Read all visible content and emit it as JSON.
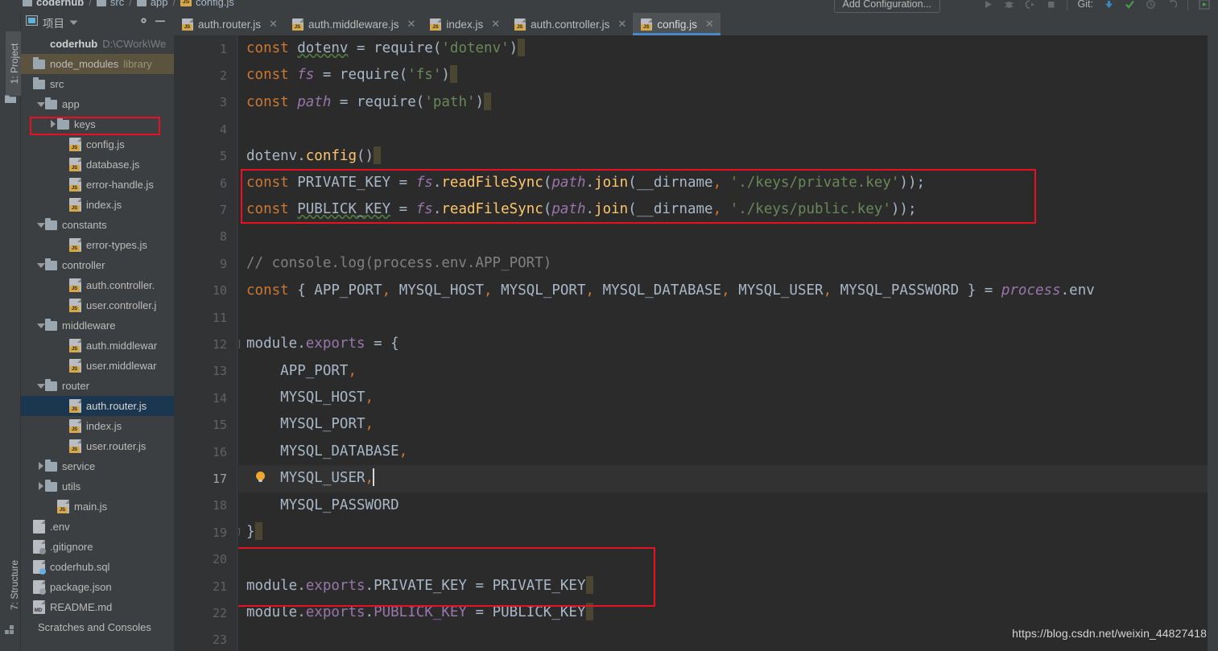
{
  "window": {
    "breadcrumb": [
      {
        "label": "coderhub",
        "icon": "folder-icon",
        "bold": true
      },
      {
        "label": "src",
        "icon": "folder-icon",
        "bold": false
      },
      {
        "label": "app",
        "icon": "folder-icon",
        "bold": false
      },
      {
        "label": "config.js",
        "icon": "js-file-icon",
        "bold": false
      }
    ],
    "run_configuration": "Add Configuration...",
    "git_label": "Git:",
    "watermark": "https://blog.csdn.net/weixin_44827418"
  },
  "toolstrips": {
    "left_top": "1: Project",
    "left_bottom": "7: Structure"
  },
  "project_panel": {
    "title": "项目",
    "dropdown_icon": "chevron-down-icon",
    "settings_icon": "gear-icon",
    "minimize_icon": "minimize-icon",
    "tree": [
      {
        "label": "coderhub",
        "sub": "D:\\CWork\\We",
        "indent": 0,
        "arrow": "none",
        "icon": "project-root",
        "bold": true,
        "state": "normal"
      },
      {
        "label": "node_modules",
        "sub": "library",
        "indent": 0,
        "arrow": "none",
        "icon": "folder-icon",
        "bold": false,
        "state": "library"
      },
      {
        "label": "src",
        "sub": "",
        "indent": 0,
        "arrow": "none",
        "icon": "folder-icon",
        "bold": false,
        "state": "normal"
      },
      {
        "label": "app",
        "sub": "",
        "indent": 1,
        "arrow": "down",
        "icon": "folder-icon",
        "bold": false,
        "state": "normal"
      },
      {
        "label": "keys",
        "sub": "",
        "indent": 2,
        "arrow": "right",
        "icon": "folder-icon",
        "bold": false,
        "state": "annotated"
      },
      {
        "label": "config.js",
        "sub": "",
        "indent": 3,
        "arrow": "none",
        "icon": "js-file-icon",
        "bold": false,
        "state": "normal"
      },
      {
        "label": "database.js",
        "sub": "",
        "indent": 3,
        "arrow": "none",
        "icon": "js-file-icon",
        "bold": false,
        "state": "normal"
      },
      {
        "label": "error-handle.js",
        "sub": "",
        "indent": 3,
        "arrow": "none",
        "icon": "js-file-icon",
        "bold": false,
        "state": "normal"
      },
      {
        "label": "index.js",
        "sub": "",
        "indent": 3,
        "arrow": "none",
        "icon": "js-file-icon",
        "bold": false,
        "state": "normal"
      },
      {
        "label": "constants",
        "sub": "",
        "indent": 1,
        "arrow": "down",
        "icon": "folder-icon",
        "bold": false,
        "state": "normal"
      },
      {
        "label": "error-types.js",
        "sub": "",
        "indent": 3,
        "arrow": "none",
        "icon": "js-file-icon",
        "bold": false,
        "state": "normal"
      },
      {
        "label": "controller",
        "sub": "",
        "indent": 1,
        "arrow": "down",
        "icon": "folder-icon",
        "bold": false,
        "state": "normal"
      },
      {
        "label": "auth.controller.",
        "sub": "",
        "indent": 3,
        "arrow": "none",
        "icon": "js-file-icon",
        "bold": false,
        "state": "normal"
      },
      {
        "label": "user.controller.j",
        "sub": "",
        "indent": 3,
        "arrow": "none",
        "icon": "js-file-icon",
        "bold": false,
        "state": "normal"
      },
      {
        "label": "middleware",
        "sub": "",
        "indent": 1,
        "arrow": "down",
        "icon": "folder-icon",
        "bold": false,
        "state": "normal"
      },
      {
        "label": "auth.middlewar",
        "sub": "",
        "indent": 3,
        "arrow": "none",
        "icon": "js-file-icon",
        "bold": false,
        "state": "normal"
      },
      {
        "label": "user.middlewar",
        "sub": "",
        "indent": 3,
        "arrow": "none",
        "icon": "js-file-icon",
        "bold": false,
        "state": "normal"
      },
      {
        "label": "router",
        "sub": "",
        "indent": 1,
        "arrow": "down",
        "icon": "folder-icon",
        "bold": false,
        "state": "normal"
      },
      {
        "label": "auth.router.js",
        "sub": "",
        "indent": 3,
        "arrow": "none",
        "icon": "js-file-icon",
        "bold": false,
        "state": "selected"
      },
      {
        "label": "index.js",
        "sub": "",
        "indent": 3,
        "arrow": "none",
        "icon": "js-file-icon",
        "bold": false,
        "state": "normal"
      },
      {
        "label": "user.router.js",
        "sub": "",
        "indent": 3,
        "arrow": "none",
        "icon": "js-file-icon",
        "bold": false,
        "state": "normal"
      },
      {
        "label": "service",
        "sub": "",
        "indent": 1,
        "arrow": "right",
        "icon": "folder-icon",
        "bold": false,
        "state": "normal"
      },
      {
        "label": "utils",
        "sub": "",
        "indent": 1,
        "arrow": "right",
        "icon": "folder-icon",
        "bold": false,
        "state": "normal"
      },
      {
        "label": "main.js",
        "sub": "",
        "indent": 2,
        "arrow": "none",
        "icon": "js-file-icon",
        "bold": false,
        "state": "normal"
      },
      {
        "label": ".env",
        "sub": "",
        "indent": 0,
        "arrow": "none",
        "icon": "env-file-icon",
        "bold": false,
        "state": "normal"
      },
      {
        "label": ".gitignore",
        "sub": "",
        "indent": 0,
        "arrow": "none",
        "icon": "gitignore-file-icon",
        "bold": false,
        "state": "normal"
      },
      {
        "label": "coderhub.sql",
        "sub": "",
        "indent": 0,
        "arrow": "none",
        "icon": "sql-file-icon",
        "bold": false,
        "state": "normal"
      },
      {
        "label": "package.json",
        "sub": "",
        "indent": 0,
        "arrow": "none",
        "icon": "json-file-icon",
        "bold": false,
        "state": "normal"
      },
      {
        "label": "README.md",
        "sub": "",
        "indent": 0,
        "arrow": "none",
        "icon": "md-file-icon",
        "bold": false,
        "state": "normal"
      },
      {
        "label": "Scratches and Consoles",
        "sub": "",
        "indent": 0,
        "arrow": "none",
        "icon": "none",
        "bold": false,
        "state": "normal"
      }
    ]
  },
  "editor": {
    "tabs": [
      {
        "label": "auth.router.js",
        "icon": "js-file-icon",
        "active": false
      },
      {
        "label": "auth.middleware.js",
        "icon": "js-file-icon",
        "active": false
      },
      {
        "label": "index.js",
        "icon": "js-file-icon",
        "active": false
      },
      {
        "label": "auth.controller.js",
        "icon": "js-file-icon",
        "active": false
      },
      {
        "label": "config.js",
        "icon": "js-file-icon",
        "active": true
      }
    ],
    "active_tab_accent": "#4a88c7",
    "line_numbers": [
      "1",
      "2",
      "3",
      "4",
      "5",
      "6",
      "7",
      "8",
      "9",
      "10",
      "11",
      "12",
      "13",
      "14",
      "15",
      "16",
      "17",
      "18",
      "19",
      "20",
      "21",
      "22",
      "23"
    ],
    "current_line": 17,
    "cursor_line_number": "17",
    "code_lines": [
      "const dotenv = require('dotenv')",
      "const fs = require('fs')",
      "const path = require('path')",
      "",
      "dotenv.config()",
      "const PRIVATE_KEY = fs.readFileSync(path.join(__dirname, './keys/private.key'));",
      "const PUBLICK_KEY = fs.readFileSync(path.join(__dirname, './keys/public.key'));",
      "",
      "// console.log(process.env.APP_PORT)",
      "const { APP_PORT, MYSQL_HOST, MYSQL_PORT, MYSQL_DATABASE, MYSQL_USER, MYSQL_PASSWORD } = process.env",
      "",
      "module.exports = {",
      "    APP_PORT,",
      "    MYSQL_HOST,",
      "    MYSQL_PORT,",
      "    MYSQL_DATABASE,",
      "    MYSQL_USER,",
      "    MYSQL_PASSWORD",
      "}",
      "",
      "module.exports.PRIVATE_KEY = PRIVATE_KEY",
      "module.exports.PUBLICK_KEY = PUBLICK_KEY",
      ""
    ],
    "annotation_color": "#e81123",
    "annotations": [
      {
        "name": "keys-folder-highlight",
        "target": "project_panel.tree.4"
      },
      {
        "name": "key-read-lines-highlight",
        "target": "editor.code_lines.5-6"
      },
      {
        "name": "key-export-lines-highlight",
        "target": "editor.code_lines.20-21"
      }
    ]
  }
}
